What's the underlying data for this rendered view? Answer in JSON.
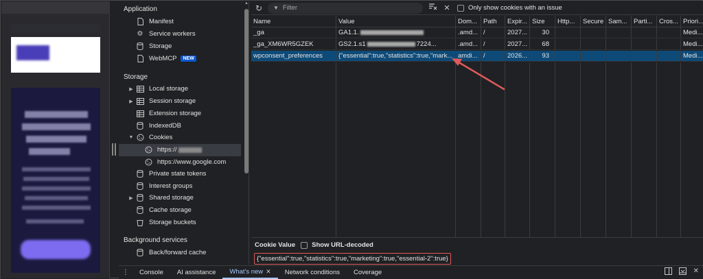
{
  "sidebar": {
    "application_header": "Application",
    "application_items": [
      {
        "label": "Manifest",
        "icon": "document-icon"
      },
      {
        "label": "Service workers",
        "icon": "gears-icon"
      },
      {
        "label": "Storage",
        "icon": "database-icon"
      },
      {
        "label": "WebMCP",
        "icon": "document-icon",
        "badge": "NEW"
      }
    ],
    "storage_header": "Storage",
    "storage_items": [
      {
        "label": "Local storage",
        "icon": "table-icon",
        "expandable": true
      },
      {
        "label": "Session storage",
        "icon": "table-icon",
        "expandable": true
      },
      {
        "label": "Extension storage",
        "icon": "table-icon",
        "expandable": false
      },
      {
        "label": "IndexedDB",
        "icon": "database-icon",
        "expandable": false
      },
      {
        "label": "Cookies",
        "icon": "cookie-icon",
        "expanded": true
      },
      {
        "label": "https://",
        "icon": "cookie-icon",
        "child": true,
        "selected": true
      },
      {
        "label": "https://www.google.com",
        "icon": "cookie-icon",
        "child": true
      },
      {
        "label": "Private state tokens",
        "icon": "database-icon"
      },
      {
        "label": "Interest groups",
        "icon": "database-icon"
      },
      {
        "label": "Shared storage",
        "icon": "database-icon",
        "expandable": true
      },
      {
        "label": "Cache storage",
        "icon": "database-icon"
      },
      {
        "label": "Storage buckets",
        "icon": "bucket-icon"
      }
    ],
    "background_header": "Background services",
    "background_items": [
      {
        "label": "Back/forward cache",
        "icon": "database-icon"
      }
    ]
  },
  "toolbar": {
    "filter_placeholder": "Filter",
    "only_issue_label": "Only show cookies with an issue"
  },
  "table": {
    "columns": [
      "Name",
      "Value",
      "Dom...",
      "Path",
      "Expir...",
      "Size",
      "Http...",
      "Secure",
      "Sam...",
      "Parti...",
      "Cros...",
      "Priori..."
    ],
    "rows": [
      {
        "name": "_ga",
        "value": "GA1.1.",
        "value_tail": "",
        "domain": ".amd...",
        "path": "/",
        "expires": "2027...",
        "size": "30",
        "priority": "Medi..."
      },
      {
        "name": "_ga_XM6WR5GZEK",
        "value": "GS2.1.s1",
        "value_tail": "7224...",
        "domain": ".amd...",
        "path": "/",
        "expires": "2027...",
        "size": "68",
        "priority": "Medi..."
      },
      {
        "name": "wpconsent_preferences",
        "value": "{\"essential\":true,\"statistics\":true,\"mark...",
        "value_tail": "",
        "domain": "amdi...",
        "path": "/",
        "expires": "2026...",
        "size": "93",
        "priority": "Medi...",
        "selected": true
      }
    ]
  },
  "cookie_value": {
    "title": "Cookie Value",
    "show_decoded_label": "Show URL-decoded",
    "text": "{\"essential\":true,\"statistics\":true,\"marketing\":true,\"essential-2\":true}"
  },
  "drawer": {
    "tabs": [
      {
        "label": "Console"
      },
      {
        "label": "AI assistance"
      },
      {
        "label": "What's new",
        "active": true,
        "closable": true
      },
      {
        "label": "Network conditions"
      },
      {
        "label": "Coverage"
      }
    ]
  },
  "colors": {
    "accent": "#a8c7fa",
    "selected_row": "#0e4a78",
    "annotation": "#e05a5a",
    "badge": "#0b57d0"
  }
}
